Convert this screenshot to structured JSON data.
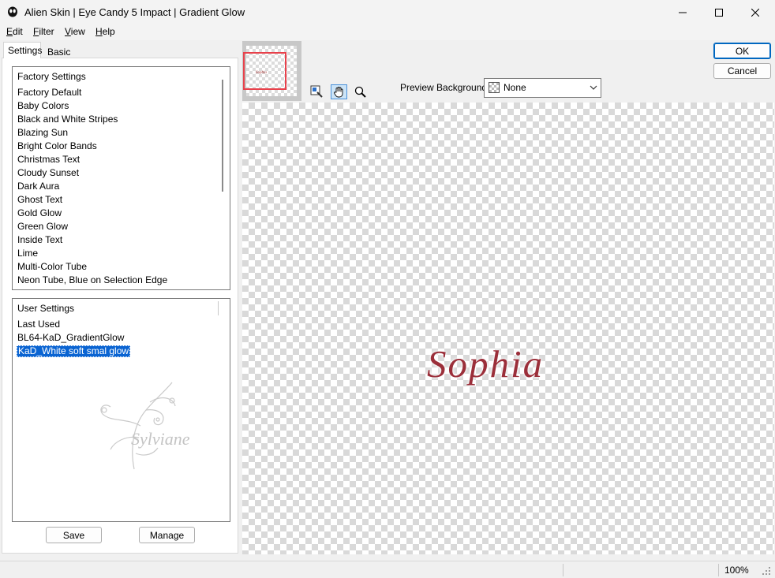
{
  "window": {
    "title": "Alien Skin | Eye Candy 5 Impact | Gradient Glow",
    "controls": [
      "minimize-icon",
      "maximize-icon",
      "close-icon"
    ]
  },
  "menu": [
    {
      "acc": "E",
      "rest": "dit"
    },
    {
      "acc": "F",
      "rest": "ilter"
    },
    {
      "acc": "V",
      "rest": "iew"
    },
    {
      "acc": "H",
      "rest": "elp"
    }
  ],
  "tabs": {
    "settings": "Settings",
    "basic": "Basic"
  },
  "factory_settings": {
    "header": "Factory Settings",
    "items": [
      "Factory Default",
      "Baby Colors",
      "Black and White Stripes",
      "Blazing Sun",
      "Bright Color Bands",
      "Christmas Text",
      "Cloudy Sunset",
      "Dark Aura",
      "Ghost Text",
      "Gold Glow",
      "Green Glow",
      "Inside Text",
      "Lime",
      "Multi-Color Tube",
      "Neon Tube, Blue on Selection Edge"
    ]
  },
  "user_settings": {
    "header": "User Settings",
    "items": [
      "Last Used",
      "BL64-KaD_GradientGlow",
      "KaD_White soft smal glow"
    ],
    "selected": "KaD_White soft smal glow"
  },
  "buttons": {
    "save": "Save",
    "manage": "Manage",
    "ok": "OK",
    "cancel": "Cancel"
  },
  "preview": {
    "background_label": "Preview Background:",
    "background_value": "None",
    "text": "Sophia",
    "text_color": "#9b2f3a",
    "thumbnail_text": "Sophia"
  },
  "watermark": {
    "text": "Sylviane"
  },
  "status": {
    "zoom": "100%"
  },
  "colors": {
    "accent": "#0067c0",
    "selection": "#0a64d2",
    "thumbnail_frame": "#e8414b"
  }
}
